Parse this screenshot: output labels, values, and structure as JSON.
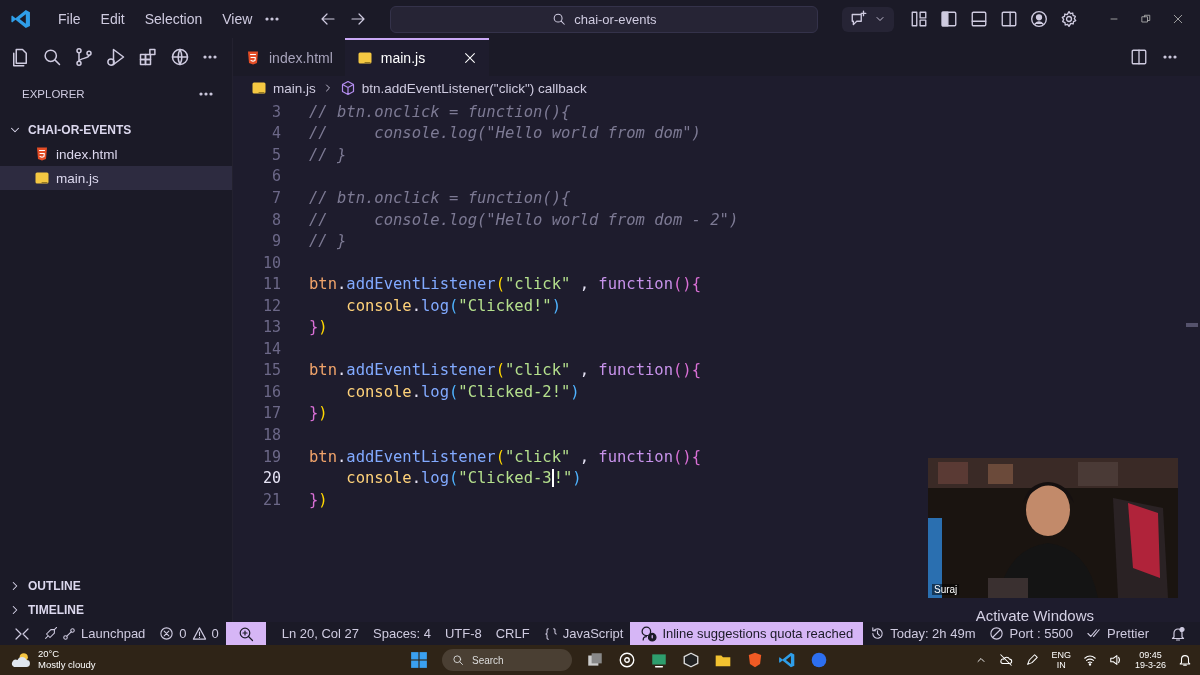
{
  "title_bar": {
    "menu": [
      "File",
      "Edit",
      "Selection",
      "View"
    ],
    "search": "chai-or-events"
  },
  "sidebar": {
    "title": "EXPLORER",
    "folder": {
      "name": "CHAI-OR-EVENTS",
      "expanded": true,
      "children": [
        {
          "name": "index.html",
          "kind": "html",
          "selected": false
        },
        {
          "name": "main.js",
          "kind": "js",
          "selected": true
        }
      ]
    },
    "sections": [
      {
        "label": "OUTLINE",
        "expanded": false
      },
      {
        "label": "TIMELINE",
        "expanded": false
      }
    ]
  },
  "tabs": [
    {
      "label": "index.html",
      "kind": "html",
      "selected": false
    },
    {
      "label": "main.js",
      "kind": "js",
      "selected": true
    }
  ],
  "breadcrumb": {
    "file": "main.js",
    "symbol": "btn.addEventListener(\"click\") callback"
  },
  "code": [
    {
      "n": "3",
      "current": false,
      "tokens": [
        {
          "kind": "comment",
          "text": "// btn.onclick = function(){"
        }
      ]
    },
    {
      "n": "4",
      "current": false,
      "tokens": [
        {
          "kind": "comment",
          "text": "//     console.log(\"Hello world from dom\")"
        }
      ]
    },
    {
      "n": "5",
      "current": false,
      "tokens": [
        {
          "kind": "comment",
          "text": "// }"
        }
      ]
    },
    {
      "n": "6",
      "current": false
    },
    {
      "n": "7",
      "current": false,
      "tokens": [
        {
          "kind": "comment",
          "text": "// btn.onclick = function(){"
        }
      ]
    },
    {
      "n": "8",
      "current": false,
      "tokens": [
        {
          "kind": "comment",
          "text": "//     console.log(\"Hello world from dom - 2\")"
        }
      ]
    },
    {
      "n": "9",
      "current": false,
      "tokens": [
        {
          "kind": "comment",
          "text": "// }"
        }
      ]
    },
    {
      "n": "10",
      "current": false
    },
    {
      "n": "11",
      "current": false,
      "tokens": [
        {
          "kind": "var",
          "text": "btn"
        },
        {
          "kind": "plain",
          "text": "."
        },
        {
          "kind": "method",
          "text": "addEventListener"
        },
        {
          "kind": "b1",
          "text": "("
        },
        {
          "kind": "str",
          "text": "\"click\""
        },
        {
          "kind": "plain",
          "text": " , "
        },
        {
          "kind": "kw",
          "text": "function"
        },
        {
          "kind": "b2",
          "text": "(){"
        }
      ]
    },
    {
      "n": "12",
      "current": false,
      "tokens": [
        {
          "kind": "obj",
          "text": "    console"
        },
        {
          "kind": "plain",
          "text": "."
        },
        {
          "kind": "method",
          "text": "log"
        },
        {
          "kind": "b3",
          "text": "("
        },
        {
          "kind": "str",
          "text": "\"Clicked!\""
        },
        {
          "kind": "b3",
          "text": ")"
        }
      ]
    },
    {
      "n": "13",
      "current": false,
      "tokens": [
        {
          "kind": "b2",
          "text": "}"
        },
        {
          "kind": "b1",
          "text": ")"
        }
      ]
    },
    {
      "n": "14",
      "current": false
    },
    {
      "n": "15",
      "current": false,
      "tokens": [
        {
          "kind": "var",
          "text": "btn"
        },
        {
          "kind": "plain",
          "text": "."
        },
        {
          "kind": "method",
          "text": "addEventListener"
        },
        {
          "kind": "b1",
          "text": "("
        },
        {
          "kind": "str",
          "text": "\"click\""
        },
        {
          "kind": "plain",
          "text": " , "
        },
        {
          "kind": "kw",
          "text": "function"
        },
        {
          "kind": "b2",
          "text": "(){"
        }
      ]
    },
    {
      "n": "16",
      "current": false,
      "tokens": [
        {
          "kind": "obj",
          "text": "    console"
        },
        {
          "kind": "plain",
          "text": "."
        },
        {
          "kind": "method",
          "text": "log"
        },
        {
          "kind": "b3",
          "text": "("
        },
        {
          "kind": "str",
          "text": "\"Clicked-2!\""
        },
        {
          "kind": "b3",
          "text": ")"
        }
      ]
    },
    {
      "n": "17",
      "current": false,
      "tokens": [
        {
          "kind": "b2",
          "text": "}"
        },
        {
          "kind": "b1",
          "text": ")"
        }
      ]
    },
    {
      "n": "18",
      "current": false
    },
    {
      "n": "19",
      "current": false,
      "tokens": [
        {
          "kind": "var",
          "text": "btn"
        },
        {
          "kind": "plain",
          "text": "."
        },
        {
          "kind": "method",
          "text": "addEventListener"
        },
        {
          "kind": "b1",
          "text": "("
        },
        {
          "kind": "str",
          "text": "\"click\""
        },
        {
          "kind": "plain",
          "text": " , "
        },
        {
          "kind": "kw",
          "text": "function"
        },
        {
          "kind": "b2",
          "text": "(){"
        }
      ]
    },
    {
      "n": "20",
      "current": true,
      "tokens": [
        {
          "kind": "obj",
          "text": "    console"
        },
        {
          "kind": "plain",
          "text": "."
        },
        {
          "kind": "method",
          "text": "log"
        },
        {
          "kind": "b3",
          "text": "("
        },
        {
          "kind": "str",
          "text": "\"Clicked-3",
          "caret": true
        },
        {
          "kind": "str",
          "text": "!\""
        },
        {
          "kind": "b3",
          "text": ")"
        }
      ]
    },
    {
      "n": "21",
      "current": false,
      "tokens": [
        {
          "kind": "b2",
          "text": "}"
        },
        {
          "kind": "b1",
          "text": ")"
        }
      ]
    }
  ],
  "webcam": {
    "kind": "picture",
    "label": "Suraj"
  },
  "overlay": {
    "text": "Activate Windows"
  },
  "status_bar": {
    "left": [
      {
        "kind": "remote"
      },
      {
        "kind": "launchpad",
        "text": "Launchpad"
      },
      {
        "kind": "problems",
        "errors": "0",
        "warnings": "0"
      },
      {
        "kind": "zoom",
        "highlighted": true
      }
    ],
    "right": [
      {
        "kind": "text",
        "text": "Ln 20, Col 27",
        "highlighted": false
      },
      {
        "kind": "text",
        "text": "Spaces: 4",
        "highlighted": false
      },
      {
        "kind": "text",
        "text": "UTF-8",
        "highlighted": false
      },
      {
        "kind": "text",
        "text": "CRLF",
        "highlighted": false
      },
      {
        "kind": "language",
        "text": "JavaScript",
        "highlighted": false
      },
      {
        "kind": "copilot",
        "text": "Inline suggestions quota reached",
        "highlighted": true
      },
      {
        "kind": "time",
        "text": "Today: 2h 49m",
        "highlighted": false
      },
      {
        "kind": "port",
        "text": "Port : 5500",
        "highlighted": false
      },
      {
        "kind": "prettier",
        "text": "Prettier",
        "highlighted": false
      },
      {
        "kind": "bell",
        "highlighted": false
      }
    ]
  },
  "taskbar": {
    "weather": {
      "temp": "20°C",
      "desc": "Mostly cloudy"
    },
    "search": "Search",
    "lang": [
      "ENG",
      "IN"
    ],
    "time": "09:45",
    "date": "19-3-26"
  }
}
